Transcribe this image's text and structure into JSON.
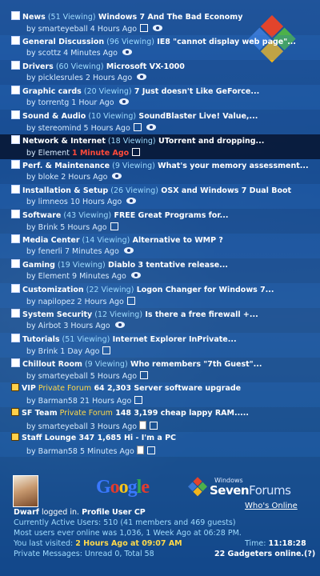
{
  "forums": [
    {
      "name": "News",
      "viewing": "(51 Viewing)",
      "thread": "Windows 7 And The Bad Economy",
      "by": "by smarteyeball",
      "time": "4 Hours Ago",
      "extras": [
        "new",
        "eye"
      ]
    },
    {
      "name": "General Discussion",
      "viewing": "(96 Viewing)",
      "thread": "IE8 \"cannot display web page\"...",
      "by": "by scottz",
      "time": "4 Minutes Ago",
      "extras": [
        "eye"
      ]
    },
    {
      "name": "Drivers",
      "viewing": "(60 Viewing)",
      "thread": "Microsoft VX-1000",
      "by": "by picklesrules",
      "time": "2 Hours Ago",
      "extras": [
        "eye"
      ]
    },
    {
      "name": "Graphic cards",
      "viewing": "(20 Viewing)",
      "thread": "7 Just doesn't Like GeForce...",
      "by": "by torrentg",
      "time": "1 Hour Ago",
      "extras": [
        "eye"
      ]
    },
    {
      "name": "Sound & Audio",
      "viewing": "(10 Viewing)",
      "thread": "SoundBlaster Live! Value,...",
      "by": "by stereomind",
      "time": "5 Hours Ago",
      "extras": [
        "new",
        "eye"
      ]
    },
    {
      "name": "Network & Internet",
      "viewing": "(18 Viewing)",
      "thread": "UTorrent and dropping...",
      "by": "by Element",
      "time": "1 Minute Ago",
      "time_red": true,
      "highlight": true,
      "extras": [
        "new"
      ]
    },
    {
      "name": "Perf. & Maintenance",
      "viewing": "(9 Viewing)",
      "thread": "What's your memory assessment...",
      "by": "by bloke",
      "time": "2 Hours Ago",
      "extras": [
        "eye"
      ]
    },
    {
      "name": "Installation & Setup",
      "viewing": "(26 Viewing)",
      "thread": "OSX and Windows 7 Dual Boot",
      "by": "by limneos",
      "time": "10 Hours Ago",
      "extras": [
        "eye"
      ]
    },
    {
      "name": "Software",
      "viewing": "(43 Viewing)",
      "thread": "FREE Great Programs for...",
      "by": "by Brink",
      "time": "5 Hours Ago",
      "extras": [
        "new"
      ]
    },
    {
      "name": "Media Center",
      "viewing": "(14 Viewing)",
      "thread": "Alternative to WMP ?",
      "by": "by fenerli",
      "time": "7 Minutes Ago",
      "extras": [
        "eye"
      ]
    },
    {
      "name": "Gaming",
      "viewing": "(19 Viewing)",
      "thread": "Diablo 3 tentative release...",
      "by": "by Element",
      "time": "9 Minutes Ago",
      "extras": [
        "eye"
      ]
    },
    {
      "name": "Customization",
      "viewing": "(22 Viewing)",
      "thread": "Logon Changer for Windows 7...",
      "by": "by napilopez",
      "time": "2 Hours Ago",
      "extras": [
        "new"
      ]
    },
    {
      "name": "System Security",
      "viewing": "(12 Viewing)",
      "thread": "Is there a free firewall +...",
      "by": "by Airbot",
      "time": "3 Hours Ago",
      "extras": [
        "eye"
      ]
    },
    {
      "name": "Tutorials",
      "viewing": "(51 Viewing)",
      "thread": "Internet Explorer InPrivate...",
      "by": "by Brink",
      "time": "1 Day Ago",
      "extras": [
        "new"
      ]
    },
    {
      "name": "Chillout Room",
      "viewing": "(9 Viewing)",
      "thread": "Who remembers \"7th Guest\"...",
      "by": "by smarteyeball",
      "time": "5 Hours Ago",
      "extras": [
        "new"
      ]
    },
    {
      "name": "VIP",
      "private_label": "Private Forum",
      "counts": "64 2,303",
      "thread": "Server software upgrade",
      "by": "by Barman58",
      "time": "21 Hours Ago",
      "private": true,
      "extras": [
        "new"
      ]
    },
    {
      "name": "SF Team",
      "private_label": "Private Forum",
      "counts": "148 3,199",
      "thread": "cheap lappy RAM.....",
      "by": "by smarteyeball",
      "time": "3 Hours Ago",
      "private": true,
      "extras": [
        "doc",
        "new"
      ]
    },
    {
      "name": "Staff Lounge",
      "counts": "347 1,685",
      "thread": "Hi - I'm a PC",
      "by": "by Barman58",
      "time": "5 Minutes Ago",
      "private": true,
      "extras": [
        "doc",
        "new"
      ]
    }
  ],
  "footer": {
    "google_letters": [
      "G",
      "o",
      "o",
      "g",
      "l",
      "e"
    ],
    "sf_windows": "Windows",
    "sf_seven": "Seven",
    "sf_forums": "Forums",
    "whos_online": "Who's Online",
    "user": "Dwarf",
    "logged_in": "logged in.",
    "profile": "Profile",
    "user_cp": "User CP",
    "active_users": "Currently Active Users: 510 (41 members and 469 guests)",
    "most_users": "Most users ever online was 1,036, 1 Week Ago at 06:28 PM.",
    "last_visited_label": "You last visited:",
    "last_visited_value": "2 Hours Ago at 09:07 AM",
    "time_label": "Time:",
    "time_value": "11:18:28",
    "pm_text": "Private Messages: Unread 0, Total 58",
    "gadgeteers": "22 Gadgeters online.(?)"
  }
}
